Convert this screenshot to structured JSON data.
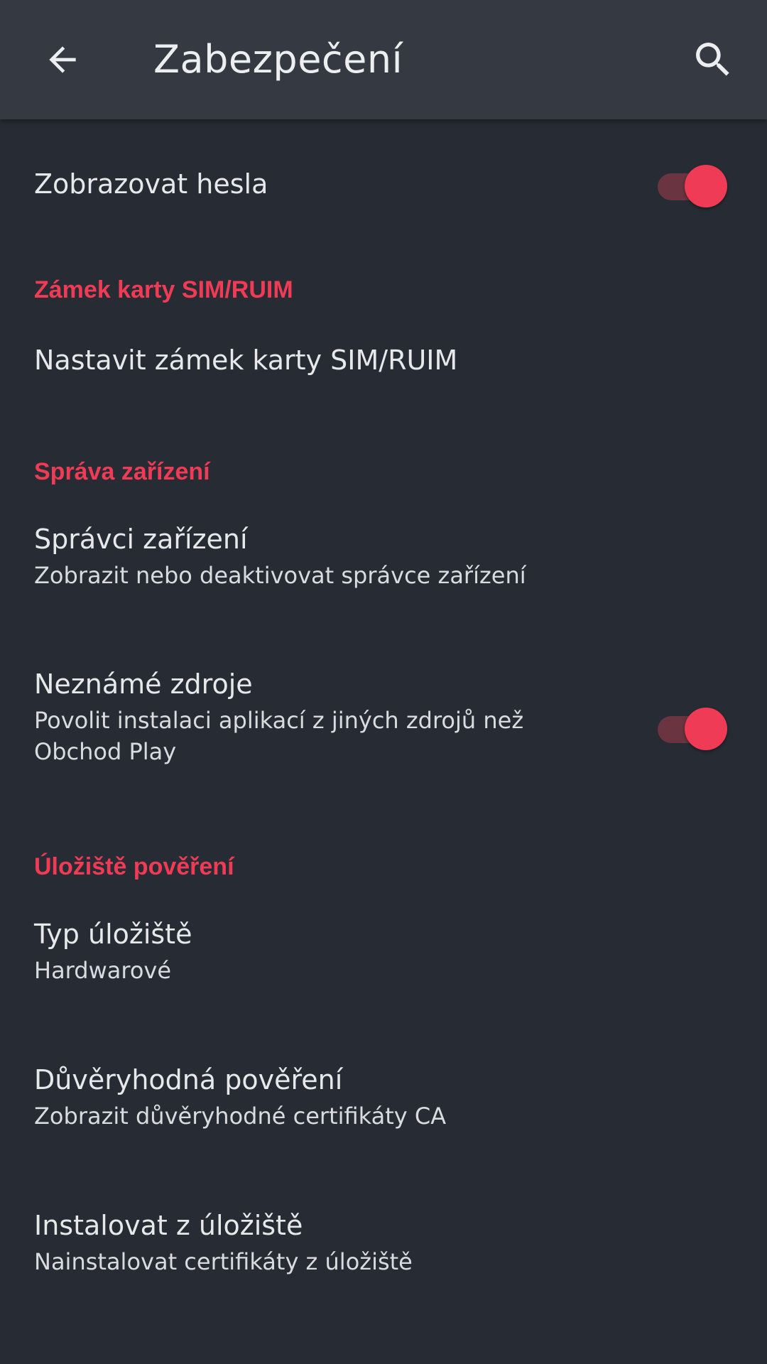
{
  "app_bar": {
    "title": "Zabezpečení",
    "back_icon": "arrow-left-icon",
    "search_icon": "search-icon"
  },
  "colors": {
    "accent": "#ef3b55",
    "background": "#272b33",
    "app_bar": "#353a42"
  },
  "settings": {
    "show_passwords": {
      "label": "Zobrazovat hesla",
      "enabled": true
    },
    "sim_section": {
      "header": "Zámek karty SIM/RUIM",
      "set_lock": "Nastavit zámek karty SIM/RUIM"
    },
    "device_section": {
      "header": "Správa zařízení",
      "admins_title": "Správci zařízení",
      "admins_summary": "Zobrazit nebo deaktivovat správce zařízení",
      "unknown_title": "Neznámé zdroje",
      "unknown_summary_line1": "Povolit instalaci aplikací z jiných zdrojů než",
      "unknown_summary_line2": "Obchod Play",
      "unknown_enabled": true
    },
    "credential_section": {
      "header": "Úložiště pověření",
      "storage_type_title": "Typ úložiště",
      "storage_type_value": "Hardwarové",
      "trusted_title": "Důvěryhodná pověření",
      "trusted_summary": "Zobrazit důvěryhodné certifikáty CA",
      "install_title": "Instalovat z úložiště",
      "install_summary": "Nainstalovat certifikáty z úložiště"
    }
  }
}
